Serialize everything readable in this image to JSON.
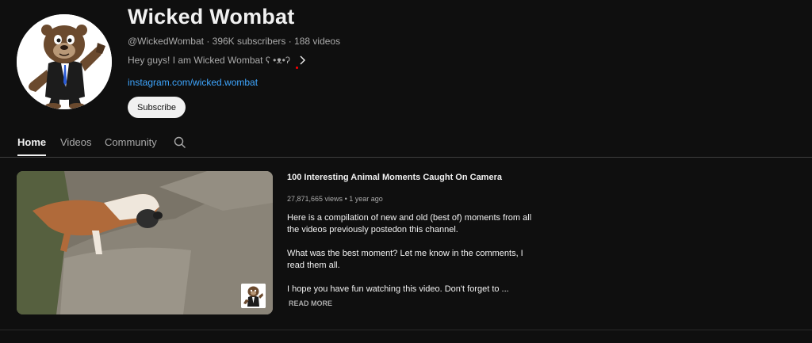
{
  "channel": {
    "name": "Wicked Wombat",
    "handle": "@WickedWombat",
    "subscribers": "396K subscribers",
    "videos": "188 videos",
    "meta_separator": " · ",
    "description": "Hey guys! I am Wicked Wombat ʕ •ᴥ•ʔ",
    "link": "instagram.com/wicked.wombat",
    "subscribe_label": "Subscribe"
  },
  "tabs": [
    {
      "label": "Home",
      "active": true
    },
    {
      "label": "Videos",
      "active": false
    },
    {
      "label": "Community",
      "active": false
    }
  ],
  "featured_video": {
    "title": "100 Interesting Animal Moments Caught On Camera",
    "views": "27,871,665 views",
    "age": "1 year ago",
    "meta_separator": " • ",
    "description": [
      "Here is a compilation of new and old (best of) moments from all the videos previously postedon this channel.",
      "What was the best moment? Let me know in the comments, I read them all.",
      "I hope you have fun watching this video. Don't forget to ..."
    ],
    "read_more": "READ MORE"
  },
  "icons": {
    "search": "search-icon",
    "chevron": "chevron-right-icon"
  },
  "colors": {
    "background": "#0f0f0f",
    "link": "#3ea6ff",
    "text_primary": "#f1f1f1",
    "text_secondary": "#aaaaaa"
  }
}
